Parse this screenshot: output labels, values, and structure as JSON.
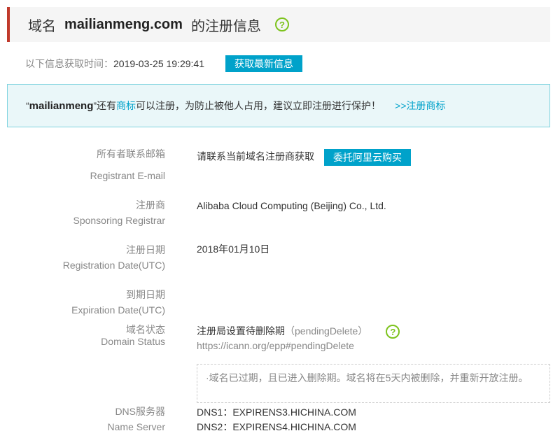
{
  "header": {
    "prefix": "域名",
    "domain": "mailianmeng.com",
    "suffix": "的注册信息",
    "help_icon": "question-circle-icon"
  },
  "fetch": {
    "label": "以下信息获取时间：",
    "time": "2019-03-25 19:29:41",
    "button": "获取最新信息"
  },
  "notice": {
    "quote_open": "“",
    "keyword": "mailianmeng",
    "quote_close": "”",
    "text_before": "还有",
    "link_trademark": "商标",
    "text_after": "可以注册，为防止被他人占用，建议立即注册进行保护！",
    "register_link": ">>注册商标"
  },
  "fields": {
    "email": {
      "label_cn": "所有者联系邮箱",
      "label_en": "Registrant E-mail",
      "value": "请联系当前域名注册商获取",
      "button": "委托阿里云购买"
    },
    "registrar": {
      "label_cn": "注册商",
      "label_en": "Sponsoring Registrar",
      "value": "Alibaba Cloud Computing (Beijing) Co., Ltd."
    },
    "reg_date": {
      "label_cn": "注册日期",
      "label_en": "Registration Date(UTC)",
      "value": "2018年01月10日"
    },
    "exp_date": {
      "label_cn": "到期日期",
      "label_en": "Expiration Date(UTC)",
      "value": ""
    },
    "status": {
      "label_cn": "域名状态",
      "label_en": "Domain Status",
      "value": "注册局设置待删除期",
      "code": "（pendingDelete）",
      "url": "https://icann.org/epp#pendingDelete",
      "help_icon": "question-circle-icon",
      "note": "·域名已过期，且已进入删除期。域名将在5天内被删除，并重新开放注册。"
    },
    "dns": {
      "label_cn": "DNS服务器",
      "label_en": "Name Server",
      "dns1": "DNS1：EXPIRENS3.HICHINA.COM",
      "dns2": "DNS2：EXPIRENS4.HICHINA.COM"
    }
  },
  "colors": {
    "accent": "#00a2ca",
    "header_bar": "#c0392b",
    "help_icon": "#7dc31d",
    "notice_bg": "#eaf7f9",
    "notice_border": "#7fd3df"
  }
}
